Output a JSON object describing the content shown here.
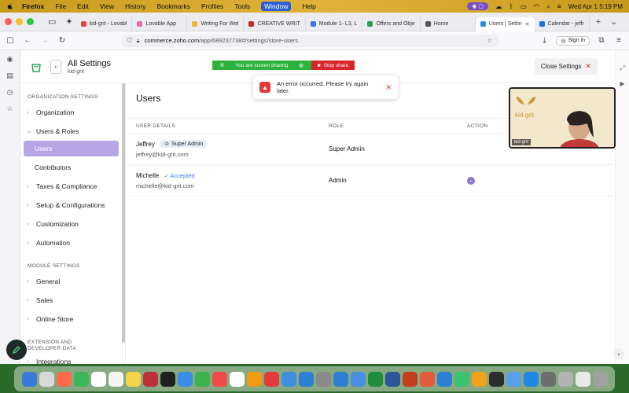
{
  "menubar": {
    "app": "Firefox",
    "items": [
      "File",
      "Edit",
      "View",
      "History",
      "Bookmarks",
      "Profiles",
      "Tools",
      "Window",
      "Help"
    ],
    "highlighted": "Window",
    "clock": "Wed Apr 1  5:19 PM"
  },
  "browser": {
    "tabs": [
      {
        "label": "kid-grit - Lovabl",
        "color": "#e0483e"
      },
      {
        "label": "Lovable App",
        "color": "#e36ea8"
      },
      {
        "label": "Writing For Wel",
        "color": "#f2b530"
      },
      {
        "label": "CREATIVE WRIT",
        "color": "#c32a2a"
      },
      {
        "label": "Module 1- L3, L",
        "color": "#3b7ae0"
      },
      {
        "label": "Offers and Obje",
        "color": "#27a048"
      },
      {
        "label": "Home",
        "color": "#555555"
      },
      {
        "label": "Users | Settin",
        "color": "#2e8bd4",
        "active": true
      },
      {
        "label": "Calendar - jeffr",
        "color": "#1b73e8"
      }
    ],
    "url_host": "commerce.zoho.com",
    "url_path": "/app/689237738#/settings/store-users",
    "sign_in": "Sign in"
  },
  "screenshare": {
    "status": "You are screen sharing",
    "stop": "Stop share"
  },
  "app": {
    "title": "All Settings",
    "subtitle": "kid-grit",
    "close_label": "Close Settings"
  },
  "sidebar": {
    "section_org": "ORGANIZATION SETTINGS",
    "org": "Organization",
    "users_roles": "Users & Roles",
    "users": "Users",
    "contributors": "Contributors",
    "taxes": "Taxes & Compliance",
    "setup": "Setup & Configurations",
    "custom": "Customization",
    "automation": "Automation",
    "section_module": "MODULE SETTINGS",
    "general": "General",
    "sales": "Sales",
    "online_store": "Online Store",
    "section_ext": "EXTENSION AND DEVELOPER DATA",
    "integrations": "Integrations"
  },
  "main": {
    "title": "Users",
    "col_user": "USER DETAILS",
    "col_role": "ROLE",
    "col_action": "ACTION",
    "rows": [
      {
        "name": "Jeffrey",
        "badge": "Super Admin",
        "email": "jeffrey@kid-grit.com",
        "role": "Super Admin"
      },
      {
        "name": "Michelle",
        "status": "Accepted",
        "email": "michelle@kid-grit.com",
        "role": "Admin"
      }
    ]
  },
  "toast": {
    "message": "An error occurred. Please try again later."
  },
  "video": {
    "label": "kid-grit",
    "logo_text": "kid-grit"
  },
  "dock": {
    "apps": [
      "#3a7ad8",
      "#d9d9d9",
      "#ff6b4a",
      "#3cb55a",
      "#ffffff",
      "#f4f4f4",
      "#f4d44a",
      "#c0303a",
      "#1f1f1f",
      "#3a8ee6",
      "#3bb54a",
      "#f04a4a",
      "#ffffff",
      "#f39c12",
      "#e43a3a",
      "#3e8fe0",
      "#2d7fd4",
      "#8a8a8a",
      "#2d7fd4",
      "#4a90e2",
      "#1e8e3e",
      "#2b579a",
      "#c43e1c",
      "#e55a3a",
      "#2d7fd4",
      "#3cc36e",
      "#f0a21a",
      "#2d2d2d",
      "#5aa0e8",
      "#1f88e5",
      "#6d6d6d",
      "#b3b3b3",
      "#e8e8e8",
      "#a0a0a0"
    ]
  }
}
